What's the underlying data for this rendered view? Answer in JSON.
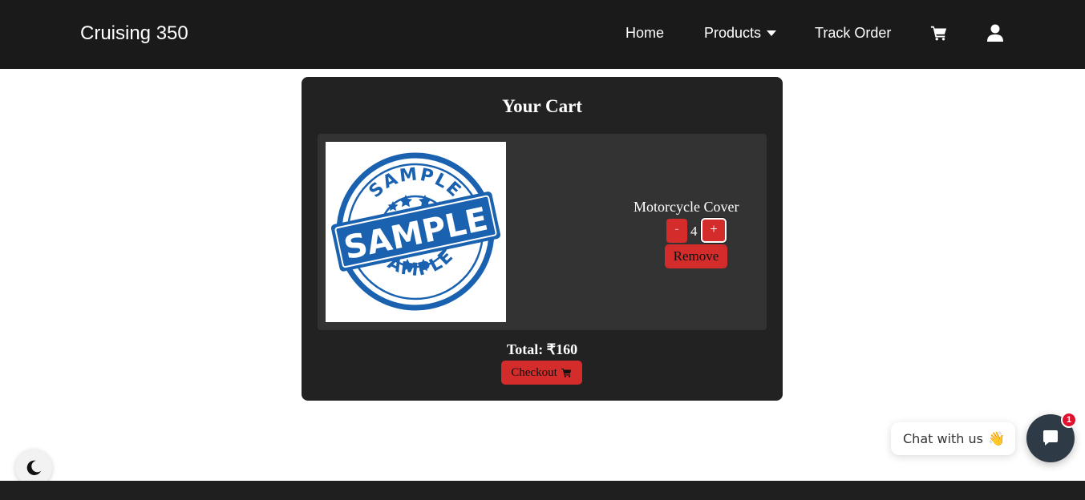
{
  "navbar": {
    "brand": "Cruising 350",
    "links": [
      {
        "label": "Home"
      },
      {
        "label": "Products"
      },
      {
        "label": "Track Order"
      }
    ],
    "icons": [
      "cart-icon",
      "user-icon",
      "caret-down-icon"
    ]
  },
  "cart": {
    "title": "Your Cart",
    "items": [
      {
        "name": "Motorcycle Cover",
        "quantity": "4",
        "minus_label": "-",
        "plus_label": "+",
        "remove_label": "Remove",
        "image": {
          "stamp_word_top": "SAMPLE",
          "stamp_word_center": "SAMPLE",
          "stamp_word_bottom": "SAMPLE",
          "stamp_color": "#1a62b0"
        }
      }
    ],
    "total": "Total: ₹160",
    "checkout_label": "Checkout"
  },
  "chat": {
    "prompt": "Chat with us",
    "emoji": "👋",
    "badge_count": "1"
  },
  "colors": {
    "navbar_bg": "#1a1a1a",
    "panel_bg": "#222222",
    "item_bg": "#333333",
    "accent_red": "#d42b2b",
    "chat_launcher": "#2f3a47",
    "badge_red": "#e0102f"
  },
  "theme_toggle_icon": "moon-icon"
}
